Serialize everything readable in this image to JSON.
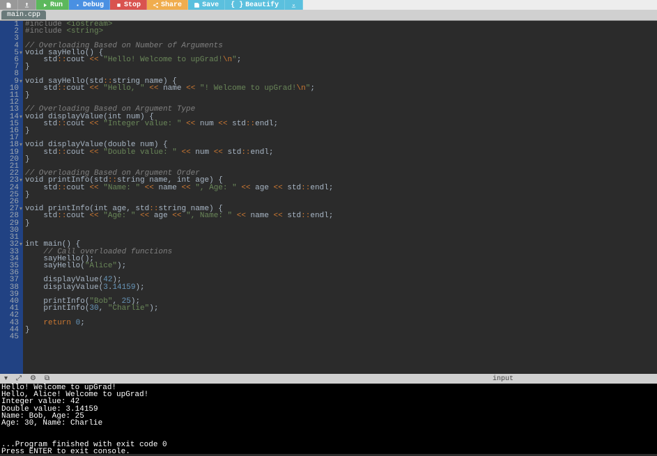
{
  "toolbar": {
    "run_label": "Run",
    "debug_label": "Debug",
    "stop_label": "Stop",
    "share_label": "Share",
    "save_label": "Save",
    "beautify_label": "Beautify"
  },
  "tabs": [
    {
      "label": "main.cpp"
    }
  ],
  "editor": {
    "lines": [
      {
        "n": 1,
        "tokens": [
          [
            "include",
            "#include "
          ],
          [
            "includebr",
            "<iostream>"
          ]
        ]
      },
      {
        "n": 2,
        "tokens": [
          [
            "include",
            "#include "
          ],
          [
            "includebr",
            "<string>"
          ]
        ]
      },
      {
        "n": 3,
        "tokens": []
      },
      {
        "n": 4,
        "tokens": [
          [
            "comment",
            "// Overloading Based on Number of Arguments"
          ]
        ]
      },
      {
        "n": 5,
        "fold": true,
        "tokens": [
          [
            "type",
            "void sayHello() {"
          ]
        ]
      },
      {
        "n": 6,
        "tokens": [
          [
            "default",
            "    std"
          ],
          [
            "colon",
            "::"
          ],
          [
            "default",
            "cout "
          ],
          [
            "op",
            "<<"
          ],
          [
            "default",
            " "
          ],
          [
            "string",
            "\"Hello! Welcome to upGrad!"
          ],
          [
            "escape",
            "\\n"
          ],
          [
            "string",
            "\""
          ],
          [
            "default",
            ";"
          ]
        ]
      },
      {
        "n": 7,
        "tokens": [
          [
            "default",
            "}"
          ]
        ]
      },
      {
        "n": 8,
        "tokens": []
      },
      {
        "n": 9,
        "fold": true,
        "tokens": [
          [
            "default",
            "void sayHello(std"
          ],
          [
            "colon",
            "::"
          ],
          [
            "default",
            "string name) {"
          ]
        ]
      },
      {
        "n": 10,
        "tokens": [
          [
            "default",
            "    std"
          ],
          [
            "colon",
            "::"
          ],
          [
            "default",
            "cout "
          ],
          [
            "op",
            "<<"
          ],
          [
            "default",
            " "
          ],
          [
            "string",
            "\"Hello, \""
          ],
          [
            "default",
            " "
          ],
          [
            "op",
            "<<"
          ],
          [
            "default",
            " name "
          ],
          [
            "op",
            "<<"
          ],
          [
            "default",
            " "
          ],
          [
            "string",
            "\"! Welcome to upGrad!"
          ],
          [
            "escape",
            "\\n"
          ],
          [
            "string",
            "\""
          ],
          [
            "default",
            ";"
          ]
        ]
      },
      {
        "n": 11,
        "tokens": [
          [
            "default",
            "}"
          ]
        ]
      },
      {
        "n": 12,
        "tokens": []
      },
      {
        "n": 13,
        "tokens": [
          [
            "comment",
            "// Overloading Based on Argument Type"
          ]
        ]
      },
      {
        "n": 14,
        "fold": true,
        "tokens": [
          [
            "default",
            "void displayValue(int num) {"
          ]
        ]
      },
      {
        "n": 15,
        "tokens": [
          [
            "default",
            "    std"
          ],
          [
            "colon",
            "::"
          ],
          [
            "default",
            "cout "
          ],
          [
            "op",
            "<<"
          ],
          [
            "default",
            " "
          ],
          [
            "string",
            "\"Integer value: \""
          ],
          [
            "default",
            " "
          ],
          [
            "op",
            "<<"
          ],
          [
            "default",
            " num "
          ],
          [
            "op",
            "<<"
          ],
          [
            "default",
            " std"
          ],
          [
            "colon",
            "::"
          ],
          [
            "default",
            "endl;"
          ]
        ]
      },
      {
        "n": 16,
        "tokens": [
          [
            "default",
            "}"
          ]
        ]
      },
      {
        "n": 17,
        "tokens": []
      },
      {
        "n": 18,
        "fold": true,
        "tokens": [
          [
            "default",
            "void displayValue(double num) {"
          ]
        ]
      },
      {
        "n": 19,
        "tokens": [
          [
            "default",
            "    std"
          ],
          [
            "colon",
            "::"
          ],
          [
            "default",
            "cout "
          ],
          [
            "op",
            "<<"
          ],
          [
            "default",
            " "
          ],
          [
            "string",
            "\"Double value: \""
          ],
          [
            "default",
            " "
          ],
          [
            "op",
            "<<"
          ],
          [
            "default",
            " num "
          ],
          [
            "op",
            "<<"
          ],
          [
            "default",
            " std"
          ],
          [
            "colon",
            "::"
          ],
          [
            "default",
            "endl;"
          ]
        ]
      },
      {
        "n": 20,
        "tokens": [
          [
            "default",
            "}"
          ]
        ]
      },
      {
        "n": 21,
        "tokens": []
      },
      {
        "n": 22,
        "tokens": [
          [
            "comment",
            "// Overloading Based on Argument Order"
          ]
        ]
      },
      {
        "n": 23,
        "fold": true,
        "tokens": [
          [
            "default",
            "void printInfo(std"
          ],
          [
            "colon",
            "::"
          ],
          [
            "default",
            "string name, int age) {"
          ]
        ]
      },
      {
        "n": 24,
        "tokens": [
          [
            "default",
            "    std"
          ],
          [
            "colon",
            "::"
          ],
          [
            "default",
            "cout "
          ],
          [
            "op",
            "<<"
          ],
          [
            "default",
            " "
          ],
          [
            "string",
            "\"Name: \""
          ],
          [
            "default",
            " "
          ],
          [
            "op",
            "<<"
          ],
          [
            "default",
            " name "
          ],
          [
            "op",
            "<<"
          ],
          [
            "default",
            " "
          ],
          [
            "string",
            "\", Age: \""
          ],
          [
            "default",
            " "
          ],
          [
            "op",
            "<<"
          ],
          [
            "default",
            " age "
          ],
          [
            "op",
            "<<"
          ],
          [
            "default",
            " std"
          ],
          [
            "colon",
            "::"
          ],
          [
            "default",
            "endl;"
          ]
        ]
      },
      {
        "n": 25,
        "tokens": [
          [
            "default",
            "}"
          ]
        ]
      },
      {
        "n": 26,
        "tokens": []
      },
      {
        "n": 27,
        "fold": true,
        "tokens": [
          [
            "default",
            "void printInfo(int age, std"
          ],
          [
            "colon",
            "::"
          ],
          [
            "default",
            "string name) {"
          ]
        ]
      },
      {
        "n": 28,
        "tokens": [
          [
            "default",
            "    std"
          ],
          [
            "colon",
            "::"
          ],
          [
            "default",
            "cout "
          ],
          [
            "op",
            "<<"
          ],
          [
            "default",
            " "
          ],
          [
            "string",
            "\"Age: \""
          ],
          [
            "default",
            " "
          ],
          [
            "op",
            "<<"
          ],
          [
            "default",
            " age "
          ],
          [
            "op",
            "<<"
          ],
          [
            "default",
            " "
          ],
          [
            "string",
            "\", Name: \""
          ],
          [
            "default",
            " "
          ],
          [
            "op",
            "<<"
          ],
          [
            "default",
            " name "
          ],
          [
            "op",
            "<<"
          ],
          [
            "default",
            " std"
          ],
          [
            "colon",
            "::"
          ],
          [
            "default",
            "endl;"
          ]
        ]
      },
      {
        "n": 29,
        "tokens": [
          [
            "default",
            "}"
          ]
        ]
      },
      {
        "n": 30,
        "tokens": []
      },
      {
        "n": 31,
        "tokens": []
      },
      {
        "n": 32,
        "fold": true,
        "tokens": [
          [
            "default",
            "int main() {"
          ]
        ]
      },
      {
        "n": 33,
        "tokens": [
          [
            "default",
            "    "
          ],
          [
            "comment",
            "// Call overloaded functions"
          ]
        ]
      },
      {
        "n": 34,
        "tokens": [
          [
            "default",
            "    sayHello();"
          ]
        ]
      },
      {
        "n": 35,
        "tokens": [
          [
            "default",
            "    sayHello("
          ],
          [
            "string",
            "\"Alice\""
          ],
          [
            "default",
            ");"
          ]
        ]
      },
      {
        "n": 36,
        "tokens": []
      },
      {
        "n": 37,
        "tokens": [
          [
            "default",
            "    displayValue("
          ],
          [
            "number",
            "42"
          ],
          [
            "default",
            ");"
          ]
        ]
      },
      {
        "n": 38,
        "tokens": [
          [
            "default",
            "    displayValue("
          ],
          [
            "number",
            "3"
          ],
          [
            "dot",
            "."
          ],
          [
            "number",
            "14159"
          ],
          [
            "default",
            ");"
          ]
        ]
      },
      {
        "n": 39,
        "tokens": []
      },
      {
        "n": 40,
        "tokens": [
          [
            "default",
            "    printInfo("
          ],
          [
            "string",
            "\"Bob\""
          ],
          [
            "default",
            ", "
          ],
          [
            "number",
            "25"
          ],
          [
            "default",
            ");"
          ]
        ]
      },
      {
        "n": 41,
        "tokens": [
          [
            "default",
            "    printInfo("
          ],
          [
            "number",
            "30"
          ],
          [
            "default",
            ", "
          ],
          [
            "string",
            "\"Charlie\""
          ],
          [
            "default",
            ");"
          ]
        ]
      },
      {
        "n": 42,
        "tokens": []
      },
      {
        "n": 43,
        "tokens": [
          [
            "default",
            "    "
          ],
          [
            "keyword",
            "return"
          ],
          [
            "default",
            " "
          ],
          [
            "number",
            "0"
          ],
          [
            "default",
            ";"
          ]
        ]
      },
      {
        "n": 44,
        "tokens": [
          [
            "default",
            "}"
          ]
        ]
      },
      {
        "n": 45,
        "tokens": []
      }
    ]
  },
  "panel": {
    "input_label": "input"
  },
  "console": {
    "lines": [
      "Hello! Welcome to upGrad!",
      "Hello, Alice! Welcome to upGrad!",
      "Integer value: 42",
      "Double value: 3.14159",
      "Name: Bob, Age: 25",
      "Age: 30, Name: Charlie",
      "",
      "",
      "...Program finished with exit code 0",
      "Press ENTER to exit console."
    ]
  }
}
